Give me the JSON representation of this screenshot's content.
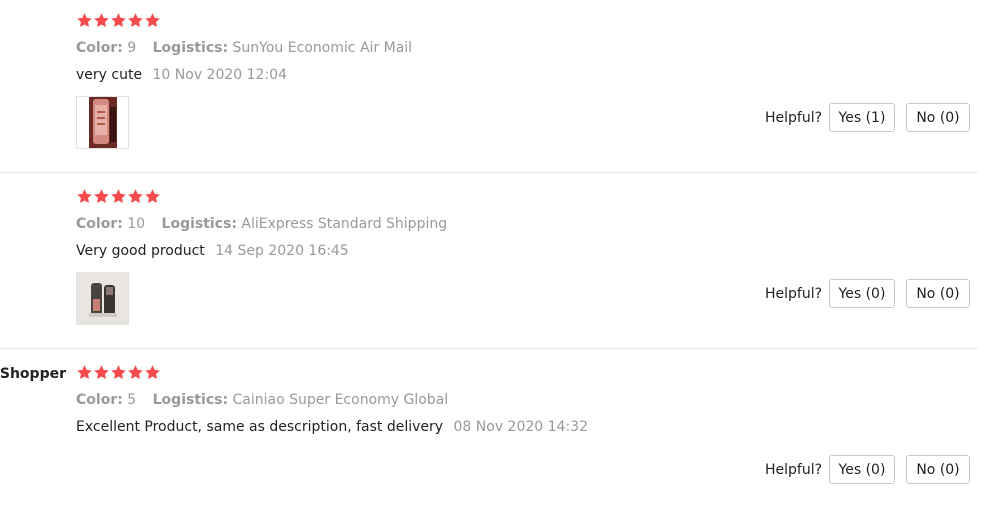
{
  "colors": {
    "star": "#f34b4b",
    "muted": "#999999",
    "text": "#222222",
    "divider": "#e8e8e8"
  },
  "helpful_label": "Helpful?",
  "reviews": [
    {
      "buyer": "",
      "rating": 5,
      "color_label": "Color:",
      "color_value": "9",
      "logistics_label": "Logistics:",
      "logistics_value": "SunYou Economic Air Mail",
      "text": "very cute",
      "date": "10 Nov 2020 12:04",
      "photo_icon": "lipstick-photo",
      "yes_label": "Yes (1)",
      "no_label": "No (0)"
    },
    {
      "buyer": "",
      "rating": 5,
      "color_label": "Color:",
      "color_value": "10",
      "logistics_label": "Logistics:",
      "logistics_value": "AliExpress Standard Shipping",
      "text": "Very good product",
      "date": "14 Sep 2020 16:45",
      "photo_icon": "lipstick-photo",
      "yes_label": "Yes (0)",
      "no_label": "No (0)"
    },
    {
      "buyer": "s Shopper",
      "rating": 5,
      "color_label": "Color:",
      "color_value": "5",
      "logistics_label": "Logistics:",
      "logistics_value": "Cainiao Super Economy Global",
      "text": "Excellent Product, same as description, fast delivery",
      "date": "08 Nov 2020 14:32",
      "photo_icon": "",
      "yes_label": "Yes (0)",
      "no_label": "No (0)"
    }
  ]
}
